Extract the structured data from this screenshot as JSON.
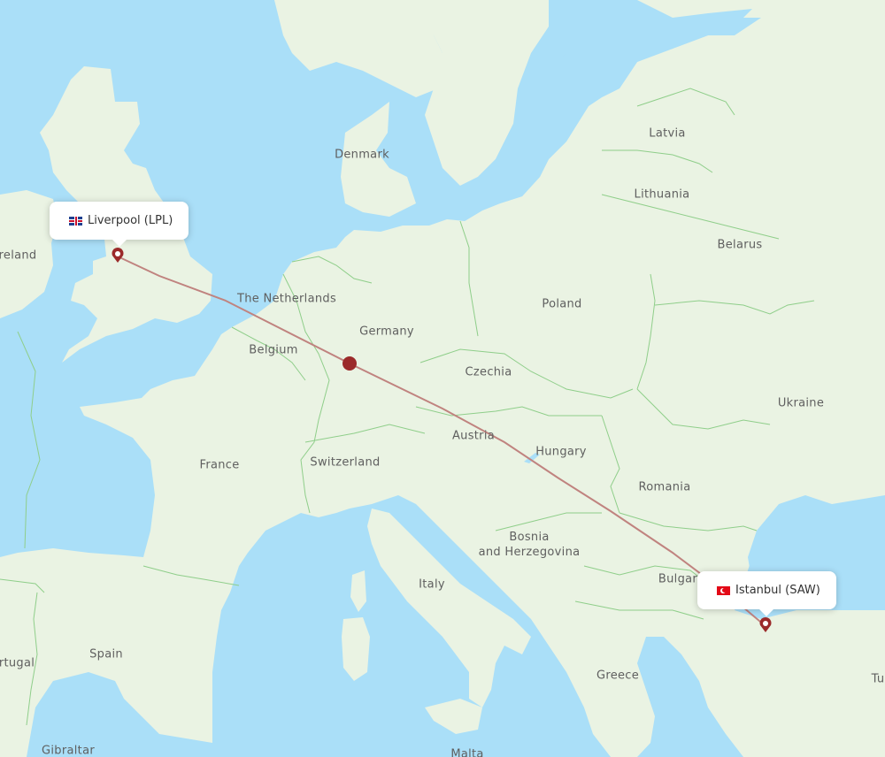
{
  "map": {
    "colors": {
      "water": "#aadff8",
      "land": "#eaf3e3",
      "border": "#8fce8a",
      "route": "#c0837f",
      "marker": "#9b2a2a"
    },
    "route": {
      "origin": {
        "city": "Liverpool",
        "code": "LPL",
        "label": "Liverpool (LPL)",
        "flag": "uk-flag"
      },
      "destination": {
        "city": "Istanbul",
        "code": "SAW",
        "label": "Istanbul (SAW)",
        "flag": "turkey-flag"
      }
    },
    "country_labels": [
      {
        "id": "denmark",
        "text": "Denmark"
      },
      {
        "id": "latvia",
        "text": "Latvia"
      },
      {
        "id": "lithuania",
        "text": "Lithuania"
      },
      {
        "id": "belarus",
        "text": "Belarus"
      },
      {
        "id": "ireland",
        "text": "reland"
      },
      {
        "id": "netherlands",
        "text": "The Netherlands"
      },
      {
        "id": "germany",
        "text": "Germany"
      },
      {
        "id": "poland",
        "text": "Poland"
      },
      {
        "id": "belgium",
        "text": "Belgium"
      },
      {
        "id": "czechia",
        "text": "Czechia"
      },
      {
        "id": "ukraine",
        "text": "Ukraine"
      },
      {
        "id": "austria",
        "text": "Austria"
      },
      {
        "id": "france",
        "text": "France"
      },
      {
        "id": "hungary",
        "text": "Hungary"
      },
      {
        "id": "switzerland",
        "text": "Switzerland"
      },
      {
        "id": "romania",
        "text": "Romania"
      },
      {
        "id": "bosnia",
        "text": "Bosnia\nand Herzegovina"
      },
      {
        "id": "italy",
        "text": "Italy"
      },
      {
        "id": "bulgaria",
        "text": "Bulgar"
      },
      {
        "id": "spain",
        "text": "Spain"
      },
      {
        "id": "portugal",
        "text": "rtugal"
      },
      {
        "id": "greece",
        "text": "Greece"
      },
      {
        "id": "turkey",
        "text": "Tu"
      },
      {
        "id": "gibraltar",
        "text": "Gibraltar"
      },
      {
        "id": "malta",
        "text": "Malta"
      }
    ]
  }
}
